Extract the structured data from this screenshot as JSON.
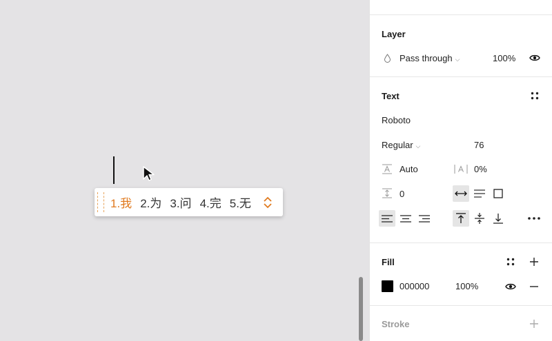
{
  "ime": {
    "candidates": [
      "1.我",
      "2.为",
      "3.问",
      "4.完",
      "5.无"
    ]
  },
  "layer": {
    "title": "Layer",
    "blend_mode": "Pass through",
    "opacity": "100%"
  },
  "text": {
    "title": "Text",
    "font_family": "Roboto",
    "font_style": "Regular",
    "font_size": "76",
    "line_height": "Auto",
    "letter_spacing": "0%",
    "paragraph_spacing": "0"
  },
  "fill": {
    "title": "Fill",
    "hex": "000000",
    "opacity": "100%",
    "color": "#000000"
  },
  "stroke": {
    "title": "Stroke"
  }
}
